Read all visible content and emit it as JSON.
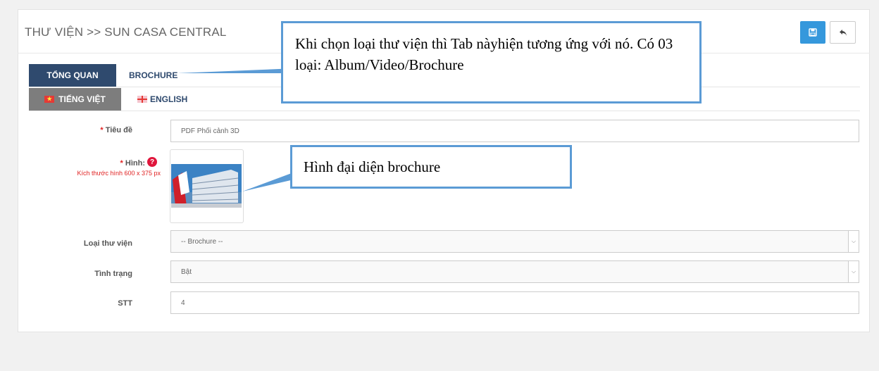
{
  "header": {
    "title": "THƯ VIỆN >> SUN CASA CENTRAL"
  },
  "toolbar": {
    "save_icon": "save-icon",
    "back_icon": "reply-icon"
  },
  "tabs": [
    {
      "label": "TỔNG QUAN"
    },
    {
      "label": "BROCHURE"
    }
  ],
  "lang_tabs": [
    {
      "label": "TIẾNG VIỆT"
    },
    {
      "label": "ENGLISH"
    }
  ],
  "form": {
    "title": {
      "label": "Tiêu đề",
      "value": "PDF Phối cảnh 3D"
    },
    "image": {
      "label": "Hình:",
      "note": "Kích thước hình 600 x 375 px"
    },
    "library_type": {
      "label": "Loại thư viện",
      "value": "-- Brochure --"
    },
    "status": {
      "label": "Tình trạng",
      "value": "Bật"
    },
    "order": {
      "label": "STT",
      "value": "4"
    }
  },
  "annotations": {
    "tab_note": "Khi chọn loại thư viện thì Tab nàyhiện tương ứng với nó. Có 03 loại: Album/Video/Brochure",
    "image_note": "Hình đại diện brochure"
  },
  "colors": {
    "primary": "#3598dc",
    "tab_active": "#2f4a6e",
    "required": "#e02222",
    "callout_border": "#5b9bd5"
  }
}
